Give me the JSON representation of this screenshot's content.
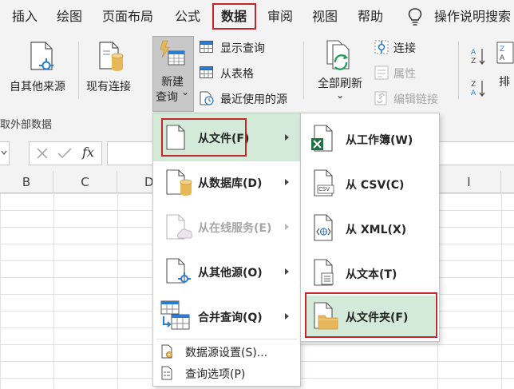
{
  "menubar": {
    "tabs": [
      "插入",
      "绘图",
      "页面布局",
      "公式",
      "数据",
      "审阅",
      "视图",
      "帮助"
    ],
    "active_tab": "数据",
    "tell_me": "操作说明搜索"
  },
  "ribbon": {
    "from_other_sources": "自其他来源",
    "existing_connections": "现有连接",
    "new_query_line1": "新建",
    "new_query_line2": "查询",
    "new_query_caret": "⌄",
    "show_queries": "显示查询",
    "from_table": "从表格",
    "recent_sources": "最近使用的源",
    "refresh_all": "全部刷新",
    "refresh_caret": "⌄",
    "connections": "连接",
    "properties": "属性",
    "edit_links": "编辑链接",
    "sort_partial": "排",
    "group_label": "获取外部数据"
  },
  "formula_bar": {
    "fx": "fx"
  },
  "columns": [
    "B",
    "C",
    "D",
    "I"
  ],
  "new_query_menu": {
    "items": [
      {
        "label": "从文件(F)",
        "has_submenu": true,
        "enabled": true,
        "highlighted": true
      },
      {
        "label": "从数据库(D)",
        "has_submenu": true,
        "enabled": true
      },
      {
        "label": "从在线服务(E)",
        "has_submenu": true,
        "enabled": false
      },
      {
        "label": "从其他源(O)",
        "has_submenu": true,
        "enabled": true
      },
      {
        "label": "合并查询(Q)",
        "has_submenu": true,
        "enabled": true
      }
    ],
    "data_source_settings": "数据源设置(S)...",
    "query_options": "查询选项(P)"
  },
  "from_file_menu": {
    "items": [
      {
        "label": "从工作簿(W)"
      },
      {
        "label": "从 CSV(C)"
      },
      {
        "label": "从 XML(X)"
      },
      {
        "label": "从文本(T)"
      },
      {
        "label": "从文件夹(F)",
        "highlighted": true
      }
    ],
    "csv_icon_text": "CSV"
  },
  "colors": {
    "highlight": "#d3ead9",
    "annotation_red": "#c0282d",
    "excel_green": "#1e7145",
    "database_gold": "#e8b856",
    "connector_blue": "#2b7cd3",
    "folder_tan": "#e8b75c"
  }
}
